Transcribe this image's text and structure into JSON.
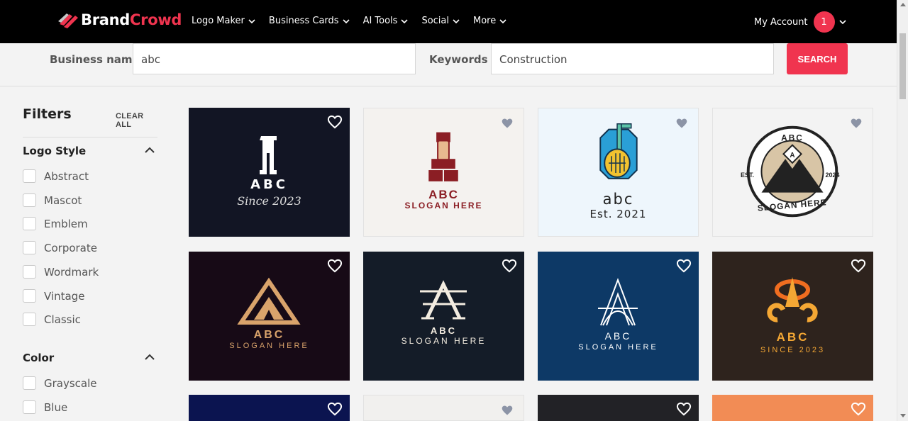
{
  "header": {
    "brand_part1": "Brand",
    "brand_part2": "Crowd",
    "nav": [
      "Logo Maker",
      "Business Cards",
      "AI Tools",
      "Social",
      "More"
    ],
    "account_label": "My Account",
    "notification_count": "1"
  },
  "search": {
    "business_label": "Business name",
    "business_value": "abc",
    "keywords_label": "Keywords",
    "keywords_value": "Construction",
    "button_label": "SEARCH"
  },
  "filters": {
    "title": "Filters",
    "clear_all": "CLEAR ALL",
    "logo_style": {
      "title": "Logo Style",
      "options": [
        "Abstract",
        "Mascot",
        "Emblem",
        "Corporate",
        "Wordmark",
        "Vintage",
        "Classic"
      ]
    },
    "color": {
      "title": "Color",
      "options": [
        "Grayscale",
        "Blue"
      ]
    }
  },
  "cards": [
    {
      "bg": "#121524",
      "name": "ABC",
      "tagline": "Since 2023",
      "text_color": "#ffffff"
    },
    {
      "bg": "#f4f2ef",
      "name": "ABC",
      "tagline": "SLOGAN HERE",
      "text_color": "#8b1e24"
    },
    {
      "bg": "#eef6fc",
      "name": "abc",
      "tagline": "Est. 2021",
      "text_color": "#222222"
    },
    {
      "bg": "#f3f3f3",
      "name": "ABC",
      "tagline": "SLOGAN HERE",
      "badge_left": "EST.",
      "badge_right": "2024",
      "text_color": "#222222"
    },
    {
      "bg": "#170a16",
      "name": "ABC",
      "tagline": "SLOGAN HERE",
      "text_color": "#d9a36b"
    },
    {
      "bg": "#141c28",
      "name": "ABC",
      "tagline": "SLOGAN HERE",
      "text_color": "#f3ece0"
    },
    {
      "bg": "#0d3966",
      "name": "ABC",
      "tagline": "SLOGAN HERE",
      "text_color": "#ffffff"
    },
    {
      "bg": "#2e231d",
      "name": "ABC",
      "tagline": "SINCE 2023",
      "text_color": "#f4a734"
    },
    {
      "bg": "#0b1450"
    },
    {
      "bg": "#f1f0ee"
    },
    {
      "bg": "#222226"
    },
    {
      "bg": "#f28c55"
    }
  ],
  "colors": {
    "accent": "#f0344f",
    "header_bg": "#000000"
  }
}
